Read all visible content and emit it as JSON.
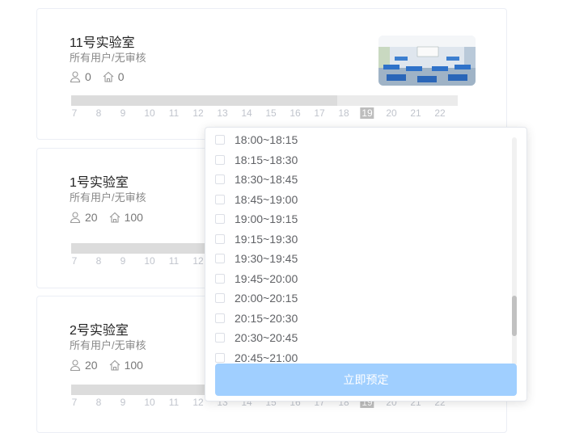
{
  "rooms": [
    {
      "title": "11号实验室",
      "subtitle": "所有用户/无审核",
      "users": "0",
      "capacity": "0"
    },
    {
      "title": "1号实验室",
      "subtitle": "所有用户/无审核",
      "users": "20",
      "capacity": "100"
    },
    {
      "title": "2号实验室",
      "subtitle": "所有用户/无审核",
      "users": "20",
      "capacity": "100"
    }
  ],
  "timeline": {
    "hours": [
      "7",
      "8",
      "9",
      "10",
      "11",
      "12",
      "13",
      "14",
      "15",
      "16",
      "17",
      "18",
      "19",
      "20",
      "21",
      "22"
    ],
    "highlight": "19"
  },
  "dropdown": {
    "options": [
      "18:00~18:15",
      "18:15~18:30",
      "18:30~18:45",
      "18:45~19:00",
      "19:00~19:15",
      "19:15~19:30",
      "19:30~19:45",
      "19:45~20:00",
      "20:00~20:15",
      "20:15~20:30",
      "20:30~20:45",
      "20:45~21:00"
    ],
    "book_label": "立即预定"
  },
  "icons": {
    "users": "person-icon",
    "capacity": "home-icon"
  },
  "colors": {
    "button": "#a0cfff",
    "bar": "#dcdcdc",
    "highlight": "#bdbdbd"
  }
}
